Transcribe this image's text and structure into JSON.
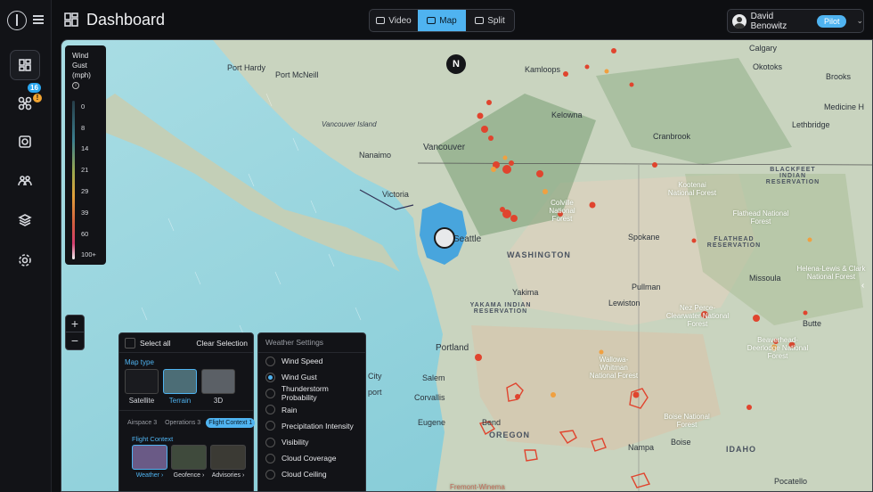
{
  "header": {
    "title": "Dashboard",
    "views": [
      {
        "label": "Video",
        "selected": false
      },
      {
        "label": "Map",
        "selected": true
      },
      {
        "label": "Split",
        "selected": false
      }
    ],
    "user": {
      "name": "David Benowitz",
      "role": "Pilot"
    }
  },
  "sidebar": {
    "fleet_badge": "16",
    "fleet_warning": "!"
  },
  "legend": {
    "title_lines": [
      "Wind",
      "Gust",
      "(mph)"
    ],
    "info": "i",
    "ticks": [
      "0",
      "8",
      "14",
      "21",
      "29",
      "39",
      "60",
      "100+"
    ]
  },
  "map": {
    "compass": "N",
    "zoom_in": "+",
    "zoom_out": "−",
    "labels": {
      "port_hardy": "Port Hardy",
      "port_mcneill": "Port McNeill",
      "kamloops": "Kamloops",
      "calgary": "Calgary",
      "okotoks": "Okotoks",
      "brooks": "Brooks",
      "kelowna": "Kelowna",
      "vancouver_island": "Vancouver Island",
      "cranbrook": "Cranbrook",
      "lethbridge": "Lethbridge",
      "medicine_hat": "Medicine H",
      "nanaimo": "Nanaimo",
      "vancouver": "Vancouver",
      "victoria": "Victoria",
      "seattle": "Seattle",
      "washington": "WASHINGTON",
      "spokane": "Spokane",
      "blackfeet": "BLACKFEET INDIAN RESERVATION",
      "kootenai": "Kootenai National Forest",
      "flathead_nf": "Flathead National Forest",
      "flathead_res": "FLATHEAD RESERVATION",
      "colville": "Colville National Forest",
      "missoula": "Missoula",
      "helena": "Helena-Lewis & Clark National Forest",
      "yakima": "Yakima",
      "yakama": "YAKAMA INDIAN RESERVATION",
      "pullman": "Pullman",
      "lewiston": "Lewiston",
      "nez_perce": "Nez Perce-Clearwater National Forest",
      "butte": "Butte",
      "beaverhead": "Beaverhead-Deerlodge National Forest",
      "portland": "Portland",
      "salem": "Salem",
      "corvallis": "Corvallis",
      "eugene": "Eugene",
      "bend": "Bend",
      "oregon": "OREGON",
      "wallowa": "Wallowa-Whitman National Forest",
      "boise_nf": "Boise National Forest",
      "nampa": "Nampa",
      "boise": "Boise",
      "idaho": "IDAHO",
      "pocatello": "Pocatello",
      "fremont": "Fremont-Winema",
      "city": "City",
      "airport": "port"
    }
  },
  "layers_panel": {
    "select_all": "Select all",
    "clear_selection": "Clear Selection",
    "map_type_title": "Map type",
    "map_types": [
      {
        "label": "Satellite",
        "selected": false
      },
      {
        "label": "Terrain",
        "selected": true
      },
      {
        "label": "3D",
        "selected": false
      }
    ],
    "tabs": [
      {
        "label": "Airspace",
        "count": "3",
        "selected": false
      },
      {
        "label": "Operations",
        "count": "3",
        "selected": false
      },
      {
        "label": "Flight Context",
        "count": "1",
        "selected": true
      }
    ],
    "flight_context_title": "Flight Context",
    "flight_context_items": [
      {
        "label": "Weather ›",
        "selected": true
      },
      {
        "label": "Geofence ›",
        "selected": false
      },
      {
        "label": "Advisories ›",
        "selected": false
      }
    ]
  },
  "weather_panel": {
    "title": "Weather Settings",
    "options": [
      {
        "label": "Wind Speed",
        "selected": false
      },
      {
        "label": "Wind Gust",
        "selected": true
      },
      {
        "label": "Thunderstorm Probability",
        "selected": false
      },
      {
        "label": "Rain",
        "selected": false
      },
      {
        "label": "Precipitation Intensity",
        "selected": false
      },
      {
        "label": "Visibility",
        "selected": false
      },
      {
        "label": "Cloud Coverage",
        "selected": false
      },
      {
        "label": "Cloud Ceiling",
        "selected": false
      }
    ]
  },
  "colors": {
    "accent": "#4fb3f0",
    "fire_red": "#e0442e",
    "fire_orange": "#f0a040",
    "water": "#8fd1d8",
    "land": "#cfd8c8"
  }
}
